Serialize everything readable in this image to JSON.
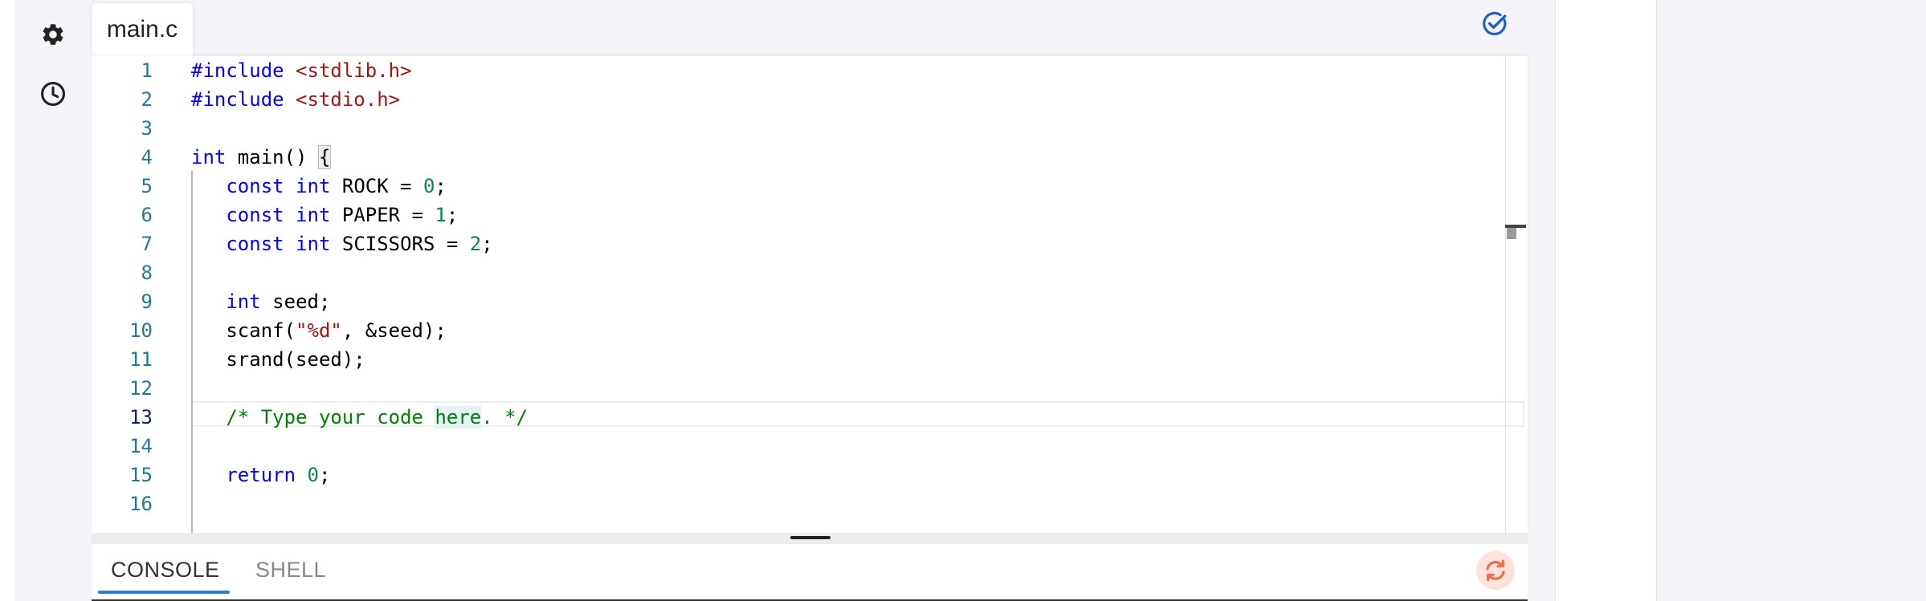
{
  "sidebar": {
    "icons": [
      "gear-icon",
      "history-icon"
    ]
  },
  "file_tab": {
    "label": "main.c"
  },
  "toolbar": {
    "check_icon": "check-circle-icon"
  },
  "editor": {
    "active_line": 13,
    "line_numbers": [
      "1",
      "2",
      "3",
      "4",
      "5",
      "6",
      "7",
      "8",
      "9",
      "10",
      "11",
      "12",
      "13",
      "14",
      "15",
      "16"
    ],
    "lines": [
      "#include <stdlib.h>",
      "#include <stdio.h>",
      "",
      "int main() {",
      "   const int ROCK = 0;",
      "   const int PAPER = 1;",
      "   const int SCISSORS = 2;",
      "",
      "   int seed;",
      "   scanf(\"%d\", &seed);",
      "   srand(seed);",
      "",
      "   /* Type your code here. */",
      "",
      "   return 0;",
      ""
    ]
  },
  "console": {
    "tabs": [
      "CONSOLE",
      "SHELL"
    ],
    "active_tab": "CONSOLE",
    "sync_icon": "sync-icon"
  },
  "colors": {
    "accent": "#2b7cd3",
    "keyword": "#0000ff",
    "string": "#a31515",
    "number": "#098658",
    "comment": "#008000",
    "line_number": "#237893",
    "sync_bg": "#fbe3dc",
    "sync_icon": "#ec6e4b"
  }
}
